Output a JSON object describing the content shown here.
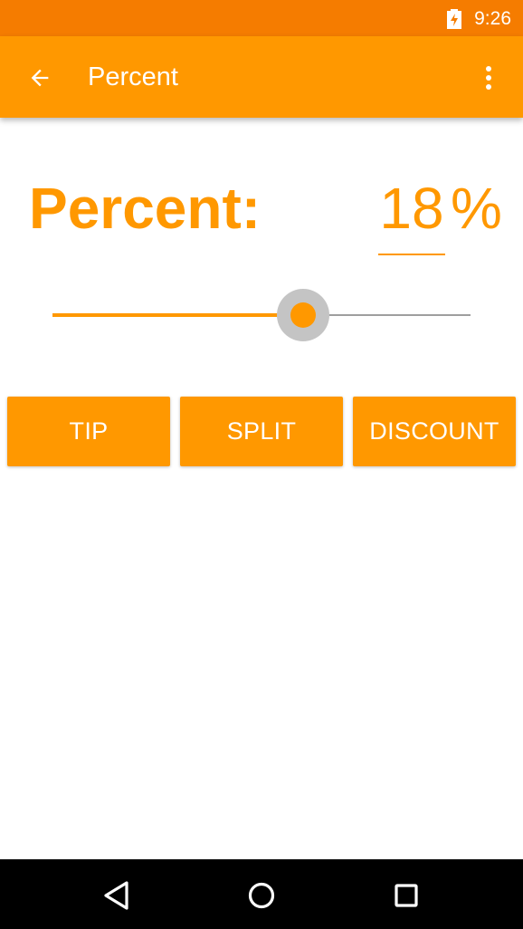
{
  "status_bar": {
    "time": "9:26",
    "battery_icon": "battery-charging-icon",
    "background_color": "#f57c00"
  },
  "app_bar": {
    "title": "Percent",
    "back_icon": "arrow-back-icon",
    "overflow_icon": "more-vert-icon",
    "background_color": "#ff9800"
  },
  "main": {
    "percent_label": "Percent:",
    "percent_value": "18",
    "percent_sign": "%",
    "slider": {
      "value": 18,
      "max": 30,
      "accent_color": "#ff9800"
    },
    "buttons": [
      {
        "label": "TIP"
      },
      {
        "label": "SPLIT"
      },
      {
        "label": "DISCOUNT"
      }
    ]
  },
  "nav_bar": {
    "back_icon": "nav-back-triangle-icon",
    "home_icon": "nav-home-circle-icon",
    "recents_icon": "nav-recents-square-icon"
  }
}
